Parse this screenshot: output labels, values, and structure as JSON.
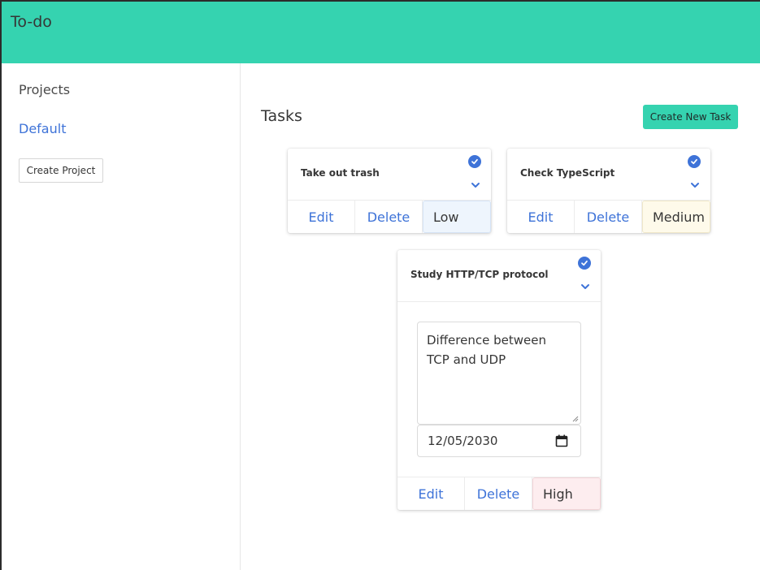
{
  "app": {
    "title": "To-do"
  },
  "sidebar": {
    "heading": "Projects",
    "projects": [
      {
        "label": "Default"
      }
    ],
    "create_project_label": "Create Project"
  },
  "main": {
    "heading": "Tasks",
    "create_task_label": "Create New Task"
  },
  "tasks": [
    {
      "title": "Take out trash",
      "completed": true,
      "expanded": false,
      "edit_label": "Edit",
      "delete_label": "Delete",
      "priority": "Low",
      "priority_color": "#eef5fd"
    },
    {
      "title": "Check TypeScript",
      "completed": true,
      "expanded": false,
      "edit_label": "Edit",
      "delete_label": "Delete",
      "priority": "Medium",
      "priority_color": "#fefaea"
    },
    {
      "title": "Study HTTP/TCP protocol",
      "completed": true,
      "expanded": true,
      "description": "Difference between TCP and UDP",
      "due_date": "12/05/2030",
      "edit_label": "Edit",
      "delete_label": "Delete",
      "priority": "High",
      "priority_color": "#fdedef"
    }
  ],
  "colors": {
    "accent": "#35d3b0",
    "link": "#3e73d8"
  },
  "icons": {
    "complete": "check-circle-icon",
    "expand": "chevron-down-icon",
    "calendar": "calendar-icon"
  }
}
